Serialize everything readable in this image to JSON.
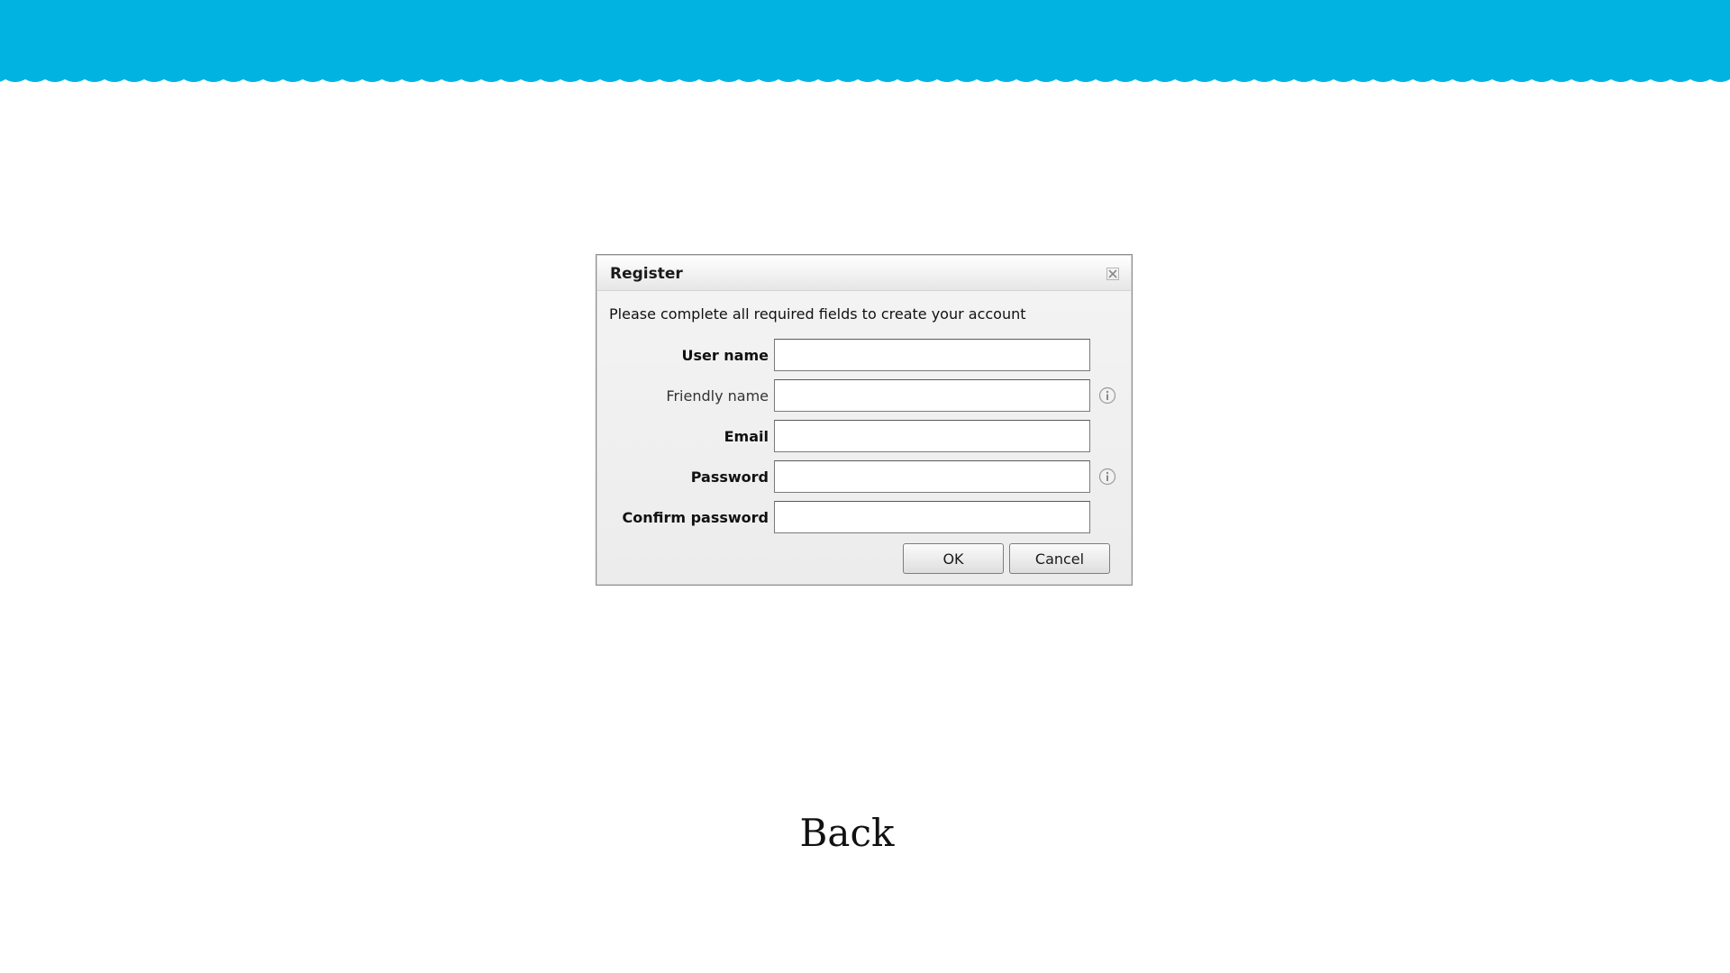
{
  "colors": {
    "banner": "#00b3e0",
    "background": "#ffffff"
  },
  "dialog": {
    "title": "Register",
    "close_icon": "close-icon",
    "instructions": "Please complete all required fields to create your account",
    "fields": [
      {
        "label": "User name",
        "value": "",
        "required": true,
        "info": false
      },
      {
        "label": "Friendly name",
        "value": "",
        "required": false,
        "info": true
      },
      {
        "label": "Email",
        "value": "",
        "required": true,
        "info": false
      },
      {
        "label": "Password",
        "value": "",
        "required": true,
        "info": true
      },
      {
        "label": "Confirm password",
        "value": "",
        "required": true,
        "info": false
      }
    ],
    "info_icon": "info-icon",
    "ok_label": "OK",
    "cancel_label": "Cancel"
  },
  "back_link": "Back"
}
